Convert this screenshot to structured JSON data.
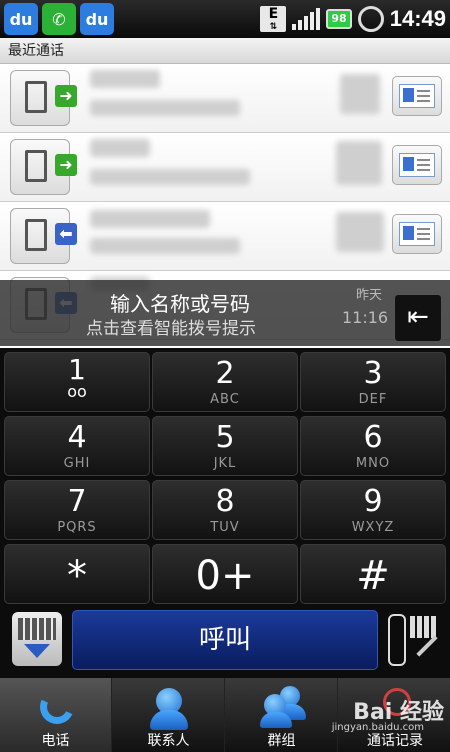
{
  "status_bar": {
    "apps": [
      "baidu",
      "wechat",
      "baidu"
    ],
    "battery": "98",
    "time": "14:49",
    "icons": [
      "e-data-icon",
      "signal-icon",
      "battery-icon",
      "alarm-icon"
    ]
  },
  "recent_calls": {
    "header": "最近通话",
    "rows": [
      {
        "type": "outgoing",
        "type_icon": "outgoing-arrow-icon"
      },
      {
        "type": "outgoing",
        "type_icon": "outgoing-arrow-icon"
      },
      {
        "type": "incoming",
        "type_icon": "incoming-arrow-icon"
      },
      {
        "type": "incoming",
        "type_icon": "incoming-arrow-icon"
      }
    ],
    "last_row_date": "昨天",
    "last_row_time": "11:16"
  },
  "input_prompt": {
    "title": "输入名称或号码",
    "subtitle": "点击查看智能拨号提示"
  },
  "keypad": {
    "keys": [
      {
        "num": "1",
        "letters": ""
      },
      {
        "num": "2",
        "letters": "ABC"
      },
      {
        "num": "3",
        "letters": "DEF"
      },
      {
        "num": "4",
        "letters": "GHI"
      },
      {
        "num": "5",
        "letters": "JKL"
      },
      {
        "num": "6",
        "letters": "MNO"
      },
      {
        "num": "7",
        "letters": "PQRS"
      },
      {
        "num": "8",
        "letters": "TUV"
      },
      {
        "num": "9",
        "letters": "WXYZ"
      },
      {
        "num": "*",
        "letters": ""
      },
      {
        "num": "0+",
        "letters": ""
      },
      {
        "num": "#",
        "letters": ""
      }
    ]
  },
  "actions": {
    "call_label": "呼叫"
  },
  "tabs": [
    {
      "label": "电话",
      "icon": "phone-icon",
      "active": true
    },
    {
      "label": "联系人",
      "icon": "contact-icon",
      "active": false
    },
    {
      "label": "群组",
      "icon": "group-icon",
      "active": false
    },
    {
      "label": "通话记录",
      "icon": "call-log-icon",
      "active": false
    }
  ],
  "watermark": {
    "brand": "Bai 经验",
    "url": "jingyan.baidu.com"
  },
  "colors": {
    "call_button": "#1b3a9a",
    "outgoing": "#38a82c",
    "incoming": "#3a63c8"
  }
}
